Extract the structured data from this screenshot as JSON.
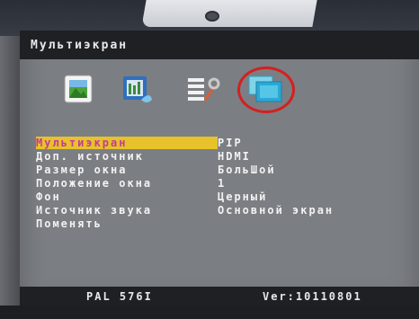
{
  "header": {
    "title": "Мультиэкран"
  },
  "tabs": [
    {
      "icon": "picture-icon"
    },
    {
      "icon": "color-icon"
    },
    {
      "icon": "settings-icon"
    },
    {
      "icon": "multiscreen-icon",
      "active": true
    }
  ],
  "menu": {
    "items": [
      {
        "label": "Мультиэкран",
        "value": "PIP",
        "selected": true
      },
      {
        "label": "Доп. источник",
        "value": "HDMI"
      },
      {
        "label": "Размер окна",
        "value": "БольШой"
      },
      {
        "label": "Положение окна",
        "value": "1"
      },
      {
        "label": "Фон",
        "value": "Церный"
      },
      {
        "label": "Источник звука",
        "value": "Основной экран"
      },
      {
        "label": "Поменять",
        "value": ""
      }
    ]
  },
  "footer": {
    "signal": "PAL  576I",
    "version": "Ver:10110801"
  },
  "colors": {
    "panel": "#7b7e83",
    "bar": "#1f2024",
    "highlight": "#e7c22a",
    "highlight_text": "#c33a9e",
    "active_ring": "#d42020"
  }
}
